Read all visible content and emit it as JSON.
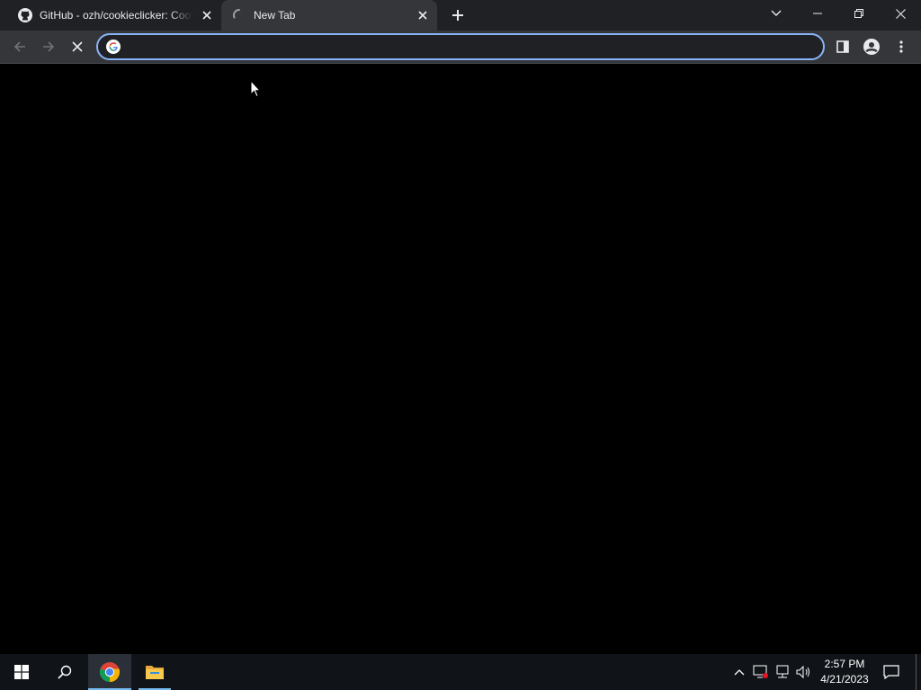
{
  "browser": {
    "tabs": [
      {
        "title": "GitHub - ozh/cookieclicker: Cookie Clicker",
        "icon": "github-icon",
        "active": false
      },
      {
        "title": "New Tab",
        "icon": "loading-spinner-icon",
        "active": true
      }
    ],
    "omnibox": {
      "value": "",
      "icon": "google-g-icon"
    },
    "colors": {
      "titlebar": "#202124",
      "toolbar": "#35363a",
      "focus_ring": "#8ab4f8",
      "content": "#000000"
    }
  },
  "taskbar": {
    "apps": [
      {
        "name": "start-icon"
      },
      {
        "name": "search-icon"
      },
      {
        "name": "chrome-icon",
        "active": true
      },
      {
        "name": "file-explorer-icon"
      }
    ],
    "clock": {
      "time": "2:57 PM",
      "date": "4/21/2023"
    }
  }
}
